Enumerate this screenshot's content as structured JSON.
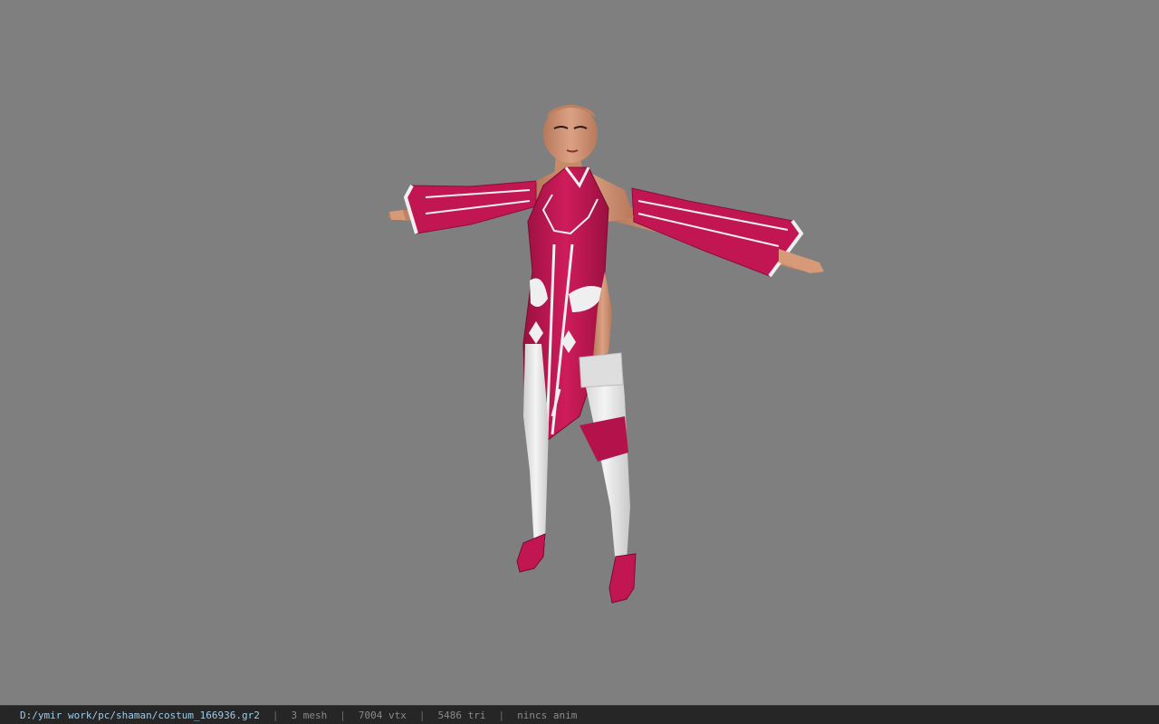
{
  "viewport": {
    "background_color": "#7f7f7f",
    "model_icon": "character-model-tpose"
  },
  "status_bar": {
    "file_path": "D:/ymir work/pc/shaman/costum_166936.gr2",
    "separator": "|",
    "mesh": "3 mesh",
    "vertices": "7004 vtx",
    "triangles": "5486 tri",
    "animation": "nincs anim"
  },
  "colors": {
    "costume": "#c21652",
    "costume_dark": "#8e0d3a",
    "trim": "#efefef",
    "skin": "#d69a78",
    "status_bg": "#262626",
    "status_path": "#9ecbe8"
  }
}
